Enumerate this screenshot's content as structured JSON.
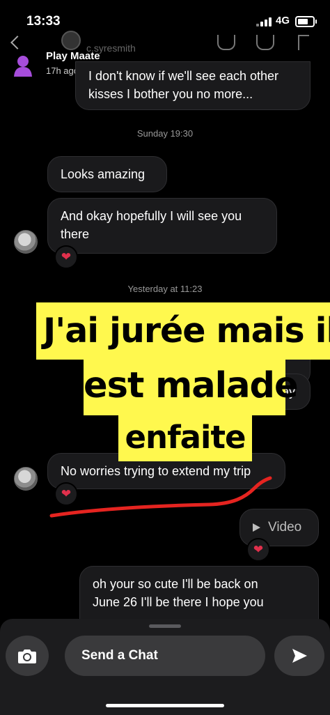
{
  "status_bar": {
    "time": "13:33",
    "network": "4G"
  },
  "header": {
    "username": "c.syresmith",
    "contact_name": "Play Maate",
    "last_active": "17h ago"
  },
  "messages": {
    "m1": {
      "line1": "I don't know if we'll see each other",
      "line2": "kisses I bother you no more..."
    },
    "ts1": "Sunday 19:30",
    "m2": "Looks amazing",
    "m3": {
      "line1": "And okay hopefully I will see you",
      "line2": "there"
    },
    "ts2": "Yesterday at 11:23",
    "m4_partial": "stay",
    "m5": "No worries trying to extend my trip",
    "video_label": "Video",
    "m6": {
      "line1": "oh your so cute I'll be back on",
      "line2": "June 26 I'll be there I hope you"
    },
    "reaction": "❤"
  },
  "overlay": {
    "line1": "J'ai jurée mais il",
    "line2": "est malade",
    "line3": "enfaite"
  },
  "composer": {
    "placeholder": "Send a Chat"
  },
  "colors": {
    "background": "#000000",
    "bubble": "#1a1a1c",
    "overlay_yellow": "#fff84e",
    "scribble_red": "#e52420",
    "heart": "#e1304c"
  },
  "icons": [
    "back-chevron-icon",
    "bitmoji-icon",
    "call-icon",
    "video-call-icon",
    "more-icon",
    "heart-icon",
    "play-icon",
    "camera-icon",
    "send-arrow-icon"
  ]
}
